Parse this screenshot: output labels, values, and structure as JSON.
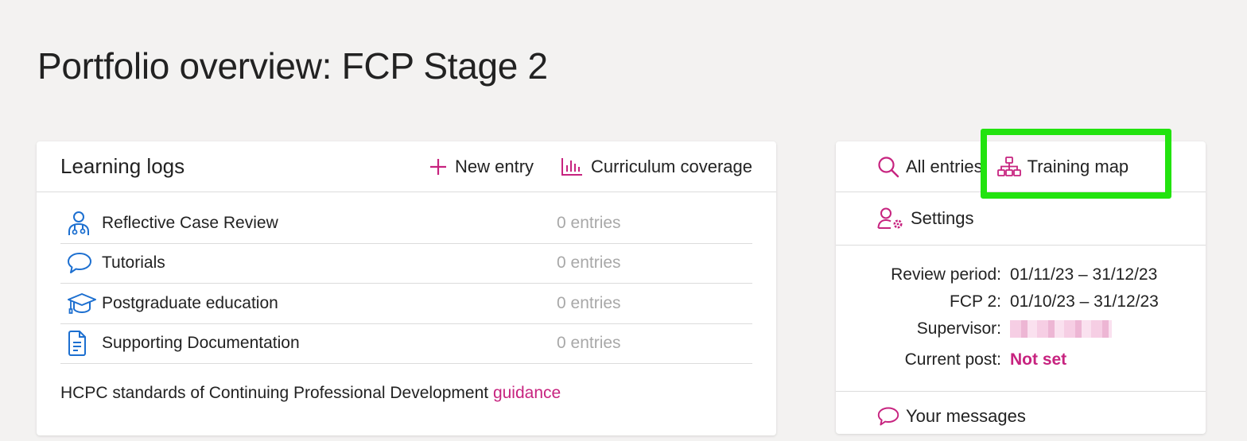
{
  "page": {
    "title": "Portfolio overview: FCP Stage 2"
  },
  "learning_logs": {
    "title": "Learning logs",
    "new_entry_label": "New entry",
    "curriculum_label": "Curriculum coverage",
    "items": [
      {
        "label": "Reflective Case Review",
        "count": "0 entries",
        "icon": "doctor-icon"
      },
      {
        "label": "Tutorials",
        "count": "0 entries",
        "icon": "speech-bubble-icon"
      },
      {
        "label": "Postgraduate education",
        "count": "0 entries",
        "icon": "graduation-cap-icon"
      },
      {
        "label": "Supporting Documentation",
        "count": "0 entries",
        "icon": "document-icon"
      }
    ],
    "guidance_text": "HCPC standards of Continuing Professional Development ",
    "guidance_link": "guidance"
  },
  "side_panel": {
    "all_entries_label": "All entries",
    "training_map_label": "Training map",
    "settings_label": "Settings",
    "review_period_label": "Review period:",
    "review_period_value": "01/11/23 – 31/12/23",
    "fcp_label": "FCP 2:",
    "fcp_value": "01/10/23 – 31/12/23",
    "supervisor_label": "Supervisor:",
    "current_post_label": "Current post:",
    "current_post_value": "Not set",
    "messages_label": "Your messages"
  },
  "colors": {
    "accent": "#c7237f",
    "icon_blue": "#1c6fd0",
    "highlight": "#22e30f",
    "muted": "#a8a8a8"
  }
}
